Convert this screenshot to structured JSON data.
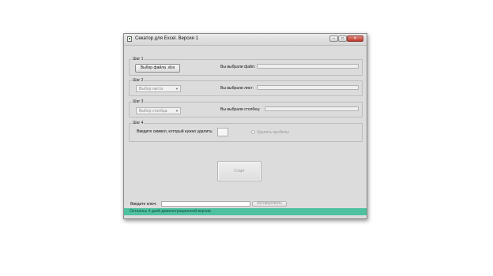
{
  "window": {
    "title": "Секатор для Excel. Версия 1",
    "minimize_glyph": "–",
    "maximize_glyph": "□",
    "close_glyph": "✕"
  },
  "steps": {
    "step1": {
      "title": "Шаг 1",
      "button_label": "Выбор файла .xlsx",
      "selected_label": "Вы выбрали файл:",
      "selected_value": ""
    },
    "step2": {
      "title": "Шаг 2",
      "combo_value": "Выбор листа",
      "selected_label": "Вы выбрали лист:",
      "selected_value": ""
    },
    "step3": {
      "title": "Шаг 3",
      "combo_value": "Выбор столбца",
      "selected_label": "Вы выбрали столбец:",
      "selected_value": ""
    },
    "step4": {
      "title": "Шаг 4",
      "symbol_label": "Введите символ, который нужно удалить:",
      "symbol_value": "",
      "remove_spaces_label": "Удалить пробелы",
      "remove_spaces_checked": false
    }
  },
  "start_button": "Старт",
  "activation": {
    "key_label": "Введите ключ:",
    "key_value": "",
    "activate_button": "Активировать"
  },
  "status": {
    "text": "Осталось 4 дней демонстрационной версии",
    "color": "#4ec1a0"
  },
  "icons": {
    "combo_arrow": "chevron-down-icon",
    "app": "app-icon"
  }
}
